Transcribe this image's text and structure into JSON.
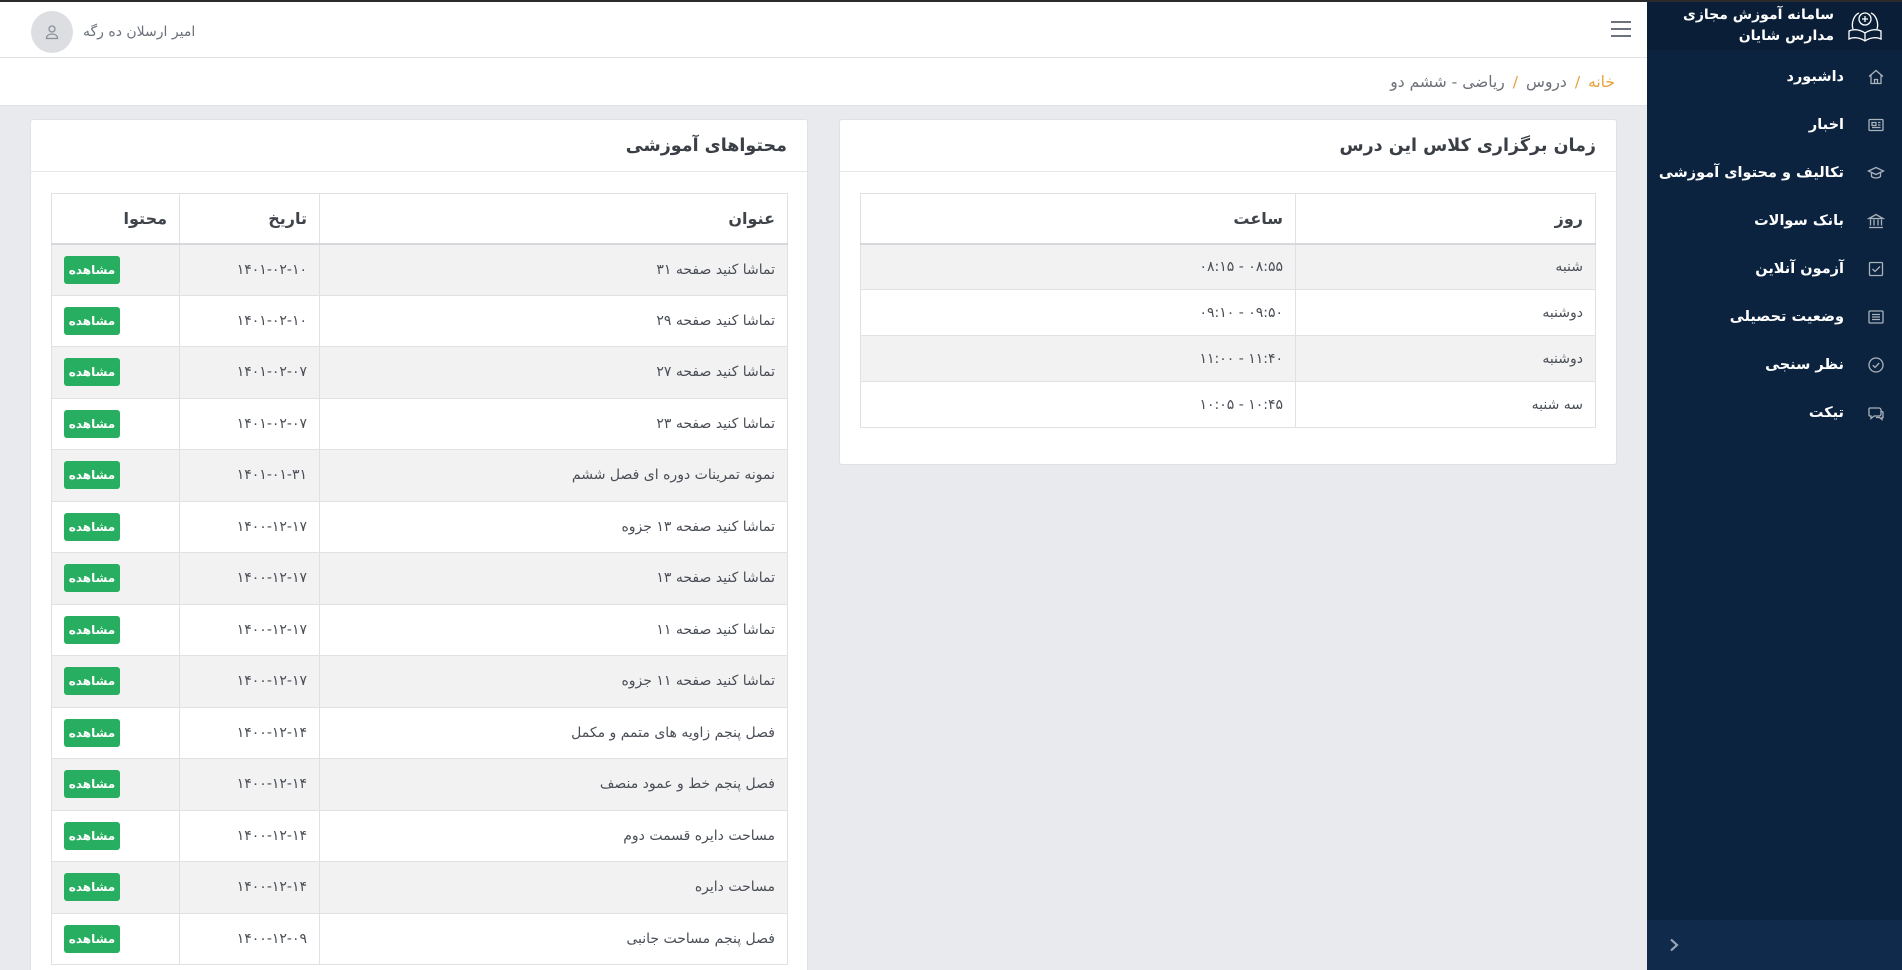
{
  "brand": {
    "title_line1": "سامانه آموزش مجازی",
    "title_line2": "مدارس شایان"
  },
  "sidebar": {
    "items": [
      {
        "label": "داشبورد",
        "icon": "home-icon"
      },
      {
        "label": "اخبار",
        "icon": "newspaper-icon"
      },
      {
        "label": "تکالیف و محتوای آموزشی",
        "icon": "graduation-cap-icon"
      },
      {
        "label": "بانک سوالات",
        "icon": "bank-icon"
      },
      {
        "label": "آزمون آنلاین",
        "icon": "checkbox-icon"
      },
      {
        "label": "وضعیت تحصیلی",
        "icon": "list-icon"
      },
      {
        "label": "نظر سنجی",
        "icon": "check-circle-icon"
      },
      {
        "label": "تیکت",
        "icon": "chat-icon"
      }
    ]
  },
  "header": {
    "username": "امیر ارسلان ده رگه"
  },
  "breadcrumb": {
    "home": "خانه",
    "section": "دروس",
    "current": "ریاضی - ششم دو"
  },
  "schedule": {
    "title": "زمان برگزاری کلاس این درس",
    "columns": [
      "روز",
      "ساعت"
    ],
    "rows": [
      {
        "day": "شنبه",
        "time": "۰۸:۵۵ - ۰۸:۱۵"
      },
      {
        "day": "دوشنبه",
        "time": "۰۹:۵۰ - ۰۹:۱۰"
      },
      {
        "day": "دوشنبه",
        "time": "۱۱:۴۰ - ۱۱:۰۰"
      },
      {
        "day": "سه شنبه",
        "time": "۱۰:۴۵ - ۱۰:۰۵"
      }
    ]
  },
  "contents": {
    "title": "محتواهای آموزشی",
    "columns": [
      "عنوان",
      "تاریخ",
      "محتوا"
    ],
    "view_label": "مشاهده",
    "rows": [
      {
        "title": "تماشا کنید صفحه ۳۱",
        "date": "۱۴۰۱-۰۲-۱۰"
      },
      {
        "title": "تماشا کنید صفحه ۲۹",
        "date": "۱۴۰۱-۰۲-۱۰"
      },
      {
        "title": "تماشا کنید صفحه ۲۷",
        "date": "۱۴۰۱-۰۲-۰۷"
      },
      {
        "title": "تماشا کنید صفحه ۲۳",
        "date": "۱۴۰۱-۰۲-۰۷"
      },
      {
        "title": "نمونه تمرینات دوره ای فصل ششم",
        "date": "۱۴۰۱-۰۱-۳۱"
      },
      {
        "title": "تماشا کنید صفحه ۱۳ جزوه",
        "date": "۱۴۰۰-۱۲-۱۷"
      },
      {
        "title": "تماشا کنید صفحه ۱۳",
        "date": "۱۴۰۰-۱۲-۱۷"
      },
      {
        "title": "تماشا کنید صفحه ۱۱",
        "date": "۱۴۰۰-۱۲-۱۷"
      },
      {
        "title": "تماشا کنید صفحه ۱۱ جزوه",
        "date": "۱۴۰۰-۱۲-۱۷"
      },
      {
        "title": "فصل پنجم زاویه های متمم و مکمل",
        "date": "۱۴۰۰-۱۲-۱۴"
      },
      {
        "title": "فصل پنجم خط و عمود منصف",
        "date": "۱۴۰۰-۱۲-۱۴"
      },
      {
        "title": "مساحت دایره قسمت دوم",
        "date": "۱۴۰۰-۱۲-۱۴"
      },
      {
        "title": "مساحت دایره",
        "date": "۱۴۰۰-۱۲-۱۴"
      },
      {
        "title": "فصل پنجم مساحت جانبی",
        "date": "۱۴۰۰-۱۲-۰۹"
      }
    ]
  }
}
